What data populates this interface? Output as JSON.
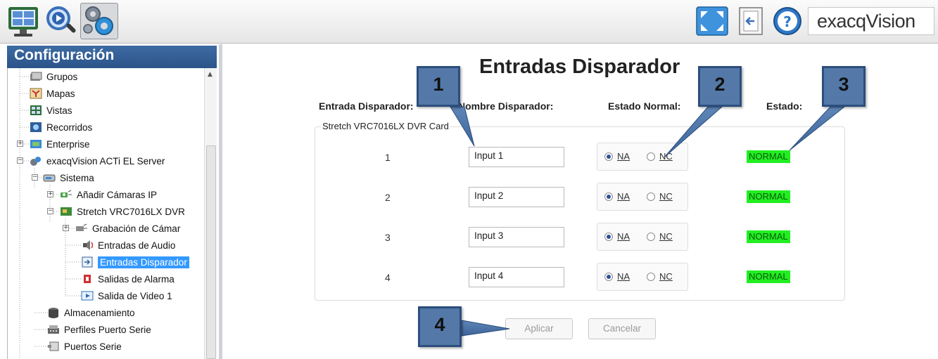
{
  "toolbar": {
    "buttons": [
      {
        "name": "live-view",
        "icon": "monitor-icon"
      },
      {
        "name": "search",
        "icon": "magnifier-icon"
      },
      {
        "name": "configuration",
        "icon": "gears-icon",
        "selected": true
      }
    ],
    "right_buttons": [
      {
        "name": "fullscreen",
        "icon": "fullscreen-icon"
      },
      {
        "name": "logout",
        "icon": "logout-icon"
      },
      {
        "name": "help",
        "icon": "help-icon"
      }
    ],
    "logo_text": "exacqVision"
  },
  "sidebar": {
    "title": "Configuración",
    "tree": [
      {
        "label": "Grupos",
        "icon": "groups-icon"
      },
      {
        "label": "Mapas",
        "icon": "map-icon"
      },
      {
        "label": "Vistas",
        "icon": "views-icon"
      },
      {
        "label": "Recorridos",
        "icon": "tours-icon"
      },
      {
        "label": "Enterprise",
        "icon": "enterprise-icon",
        "expandable": true
      },
      {
        "label": "exacqVision ACTi EL Server",
        "icon": "server-icon",
        "expandable": true,
        "expanded": true
      },
      {
        "label": "Sistema",
        "icon": "system-icon",
        "expandable": true,
        "expanded": true
      },
      {
        "label": "Añadir Cámaras IP",
        "icon": "ip-camera-icon",
        "expandable": true
      },
      {
        "label": "Stretch VRC7016LX DVR",
        "icon": "dvr-card-icon",
        "expandable": true,
        "expanded": true
      },
      {
        "label": "Grabación de Cámar",
        "icon": "recording-icon",
        "expandable": true
      },
      {
        "label": "Entradas de Audio",
        "icon": "audio-icon"
      },
      {
        "label": "Entradas Disparador",
        "icon": "trigger-icon",
        "selected": true
      },
      {
        "label": "Salidas de Alarma",
        "icon": "alarm-icon"
      },
      {
        "label": "Salida de Video 1",
        "icon": "video-output-icon"
      },
      {
        "label": "Almacenamiento",
        "icon": "storage-icon"
      },
      {
        "label": "Perfiles Puerto Serie",
        "icon": "serial-profile-icon"
      },
      {
        "label": "Puertos Serie",
        "icon": "serial-port-icon"
      }
    ]
  },
  "main": {
    "title": "Entradas Disparador",
    "columns": {
      "input": "Entrada Disparador:",
      "name": "Nombre Disparador:",
      "normal_state": "Estado Normal:",
      "state": "Estado:"
    },
    "group_label": "Stretch VRC7016LX DVR Card",
    "rows": [
      {
        "num": "1",
        "name": "Input 1",
        "na": "NA",
        "nc": "NC",
        "selected": "NA",
        "status": "NORMAL"
      },
      {
        "num": "2",
        "name": "Input 2",
        "na": "NA",
        "nc": "NC",
        "selected": "NA",
        "status": "NORMAL"
      },
      {
        "num": "3",
        "name": "Input 3",
        "na": "NA",
        "nc": "NC",
        "selected": "NA",
        "status": "NORMAL"
      },
      {
        "num": "4",
        "name": "Input 4",
        "na": "NA",
        "nc": "NC",
        "selected": "NA",
        "status": "NORMAL"
      }
    ],
    "apply_label": "Aplicar",
    "cancel_label": "Cancelar"
  },
  "callouts": [
    "1",
    "2",
    "3",
    "4"
  ],
  "colors": {
    "header_blue": "#2f5b92",
    "selection_blue": "#3399ff",
    "status_green": "#22ee22",
    "callout_fill": "#5479a9"
  }
}
